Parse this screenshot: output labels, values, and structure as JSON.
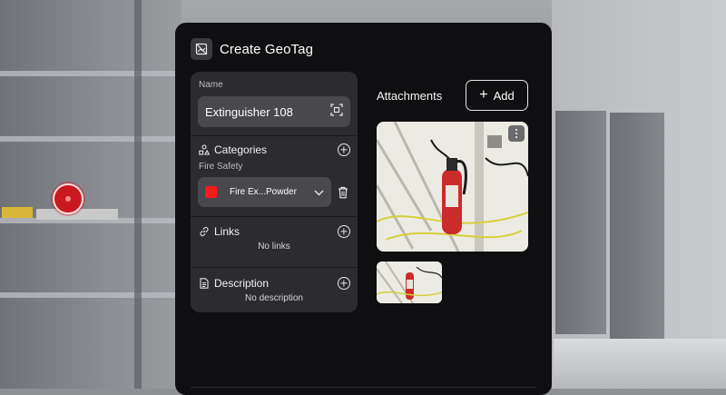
{
  "header": {
    "title": "Create GeoTag",
    "icon": "no-image-icon"
  },
  "name_field": {
    "label": "Name",
    "value": "Extinguisher 108",
    "scan_icon": "scan-icon"
  },
  "categories": {
    "title": "Categories",
    "group": "Fire Safety",
    "selected": "Fire Ex...Powder",
    "swatch_color": "#ff1a1a",
    "icon": "categories-icon"
  },
  "links": {
    "title": "Links",
    "empty": "No links",
    "icon": "link-icon"
  },
  "description": {
    "title": "Description",
    "empty": "No description",
    "icon": "document-icon"
  },
  "attachments": {
    "title": "Attachments",
    "add_label": "Add",
    "add_icon": "plus-icon"
  },
  "colors": {
    "panel": "#0f0f11",
    "card": "#2c2c30",
    "input": "#48484d",
    "marker": "#c91820"
  }
}
